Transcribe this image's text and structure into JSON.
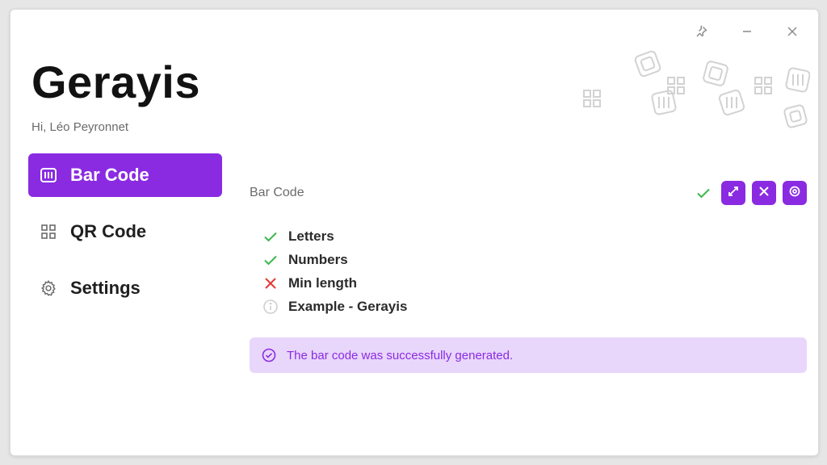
{
  "app": {
    "title": "Gerayis",
    "greeting": "Hi, Léo Peyronnet"
  },
  "titlebar": {
    "icons": [
      "pin-icon",
      "minimize-icon",
      "close-icon"
    ]
  },
  "sidebar": {
    "items": [
      {
        "label": "Bar Code",
        "icon": "barcode-icon",
        "active": true
      },
      {
        "label": "QR Code",
        "icon": "qrcode-icon",
        "active": false
      },
      {
        "label": "Settings",
        "icon": "gear-icon",
        "active": false
      }
    ]
  },
  "main": {
    "section_title": "Bar Code",
    "action_icons": [
      "status-check-icon",
      "expand-icon",
      "clear-icon",
      "settings-icon"
    ],
    "checks": [
      {
        "label": "Letters",
        "status": "ok"
      },
      {
        "label": "Numbers",
        "status": "ok"
      },
      {
        "label": "Min length",
        "status": "fail"
      },
      {
        "label": "Example - Gerayis",
        "status": "info"
      }
    ],
    "alert": {
      "message": "The bar code was successfully generated."
    }
  },
  "colors": {
    "accent": "#8a2be2",
    "success": "#3cb84a",
    "error": "#e53935",
    "alert_bg": "#e8d6fb"
  }
}
